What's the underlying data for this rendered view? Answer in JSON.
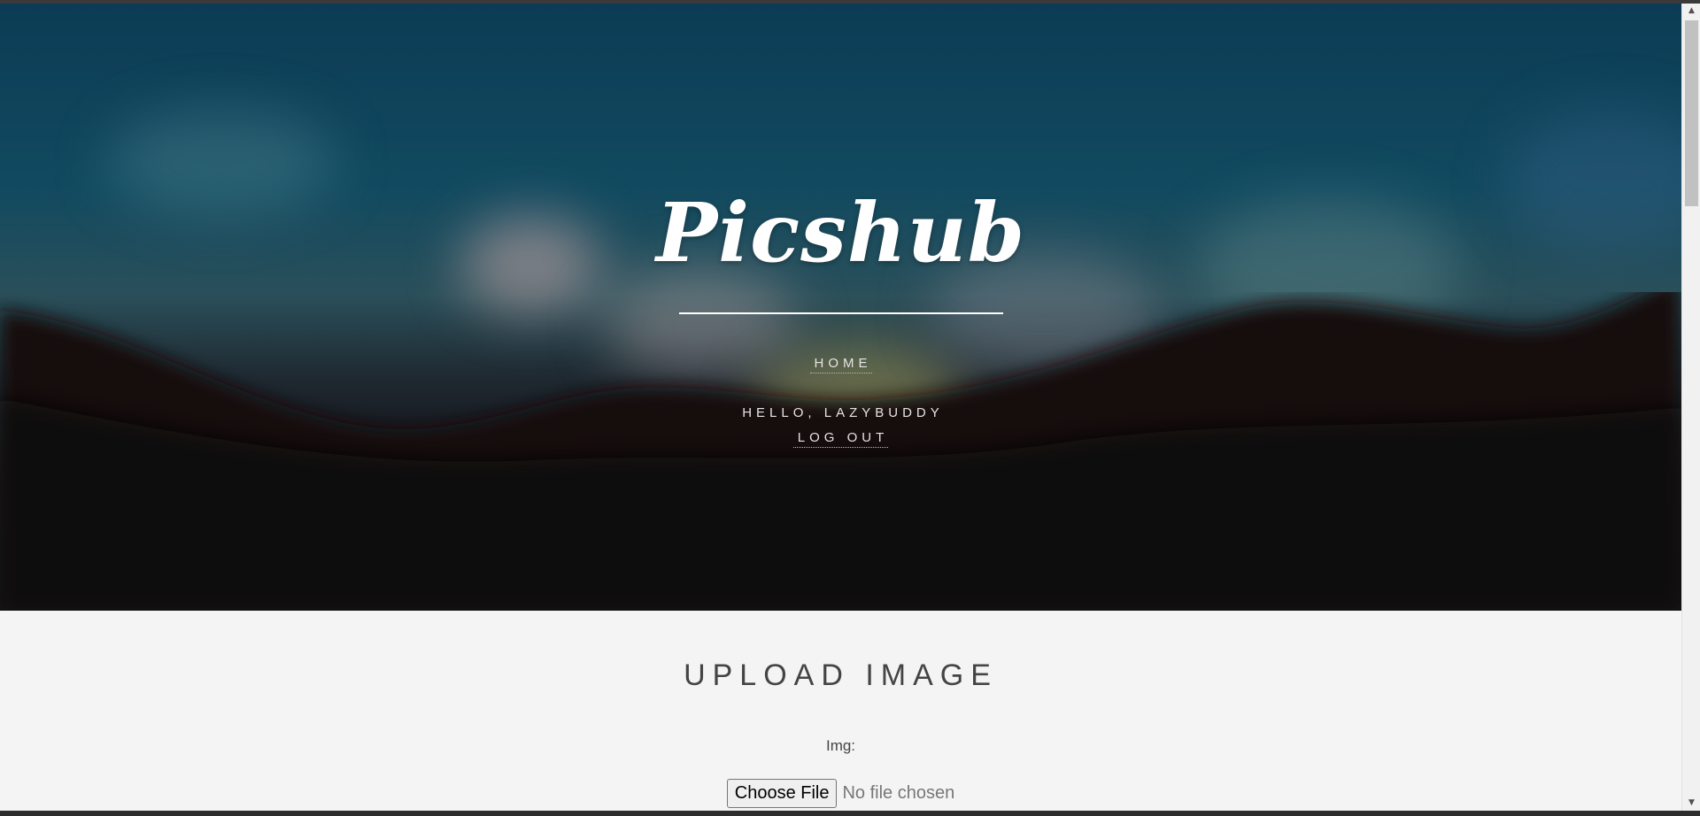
{
  "hero": {
    "logo": "Picshub",
    "nav": {
      "home_label": "HOME",
      "greeting": "HELLO, LAZYBUDDY",
      "logout_label": "LOG OUT"
    }
  },
  "upload": {
    "title": "UPLOAD IMAGE",
    "img_label": "Img:",
    "choose_file_label": "Choose File",
    "file_status": "No file chosen"
  },
  "icons": {
    "scroll_up": "scroll-up-arrow-icon",
    "scroll_down": "scroll-down-arrow-icon"
  }
}
